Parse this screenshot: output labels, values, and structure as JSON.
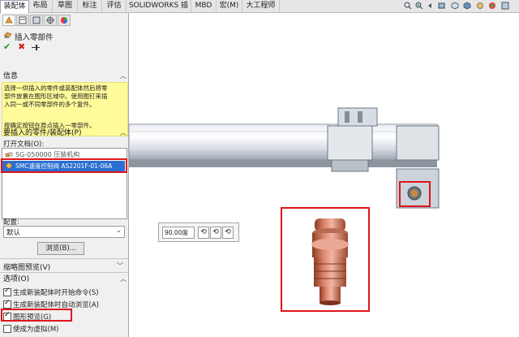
{
  "tabs": [
    "装配体",
    "布局",
    "草图",
    "标注",
    "评估",
    "SOLIDWORKS 插件",
    "MBD",
    "宏(M)",
    "大工程师"
  ],
  "panel": {
    "title": "插入零部件",
    "info_header": "信息",
    "info_text": [
      "选择一供插入的零件或装配体然后将零",
      "部件放置在图形区域中。使用图钉来插",
      "入同一或不同零部件的多个复件。",
      "",
      "按确定按钮在原点插入一零部件。"
    ],
    "part_header": "要插入的零件/装配体(P)",
    "open_docs_label": "打开文档(O):",
    "open_docs": [
      "SG-050000 压装机构",
      "SMC速度控制阀 AS2201F-01-06A"
    ],
    "config_label": "配置:",
    "config_value": "默认",
    "browse_button": "浏览(B)...",
    "thumb_preview": "缩略图预览(V)",
    "options_header": "选项(O)",
    "options": [
      {
        "label": "生成新装配体时开始命令(S)",
        "checked": true
      },
      {
        "label": "生成新装配体时自动浏览(A)",
        "checked": true
      },
      {
        "label": "图形预览(G)",
        "checked": true
      },
      {
        "label": "使成为虚拟(M)",
        "checked": false
      }
    ]
  },
  "rotate_box": {
    "value": "90.00度"
  },
  "colors": {
    "highlight_red": "#e0151b",
    "selection_blue": "#2a6fd1",
    "info_yellow": "#fffb9a",
    "part_copper": "#d9836b"
  }
}
